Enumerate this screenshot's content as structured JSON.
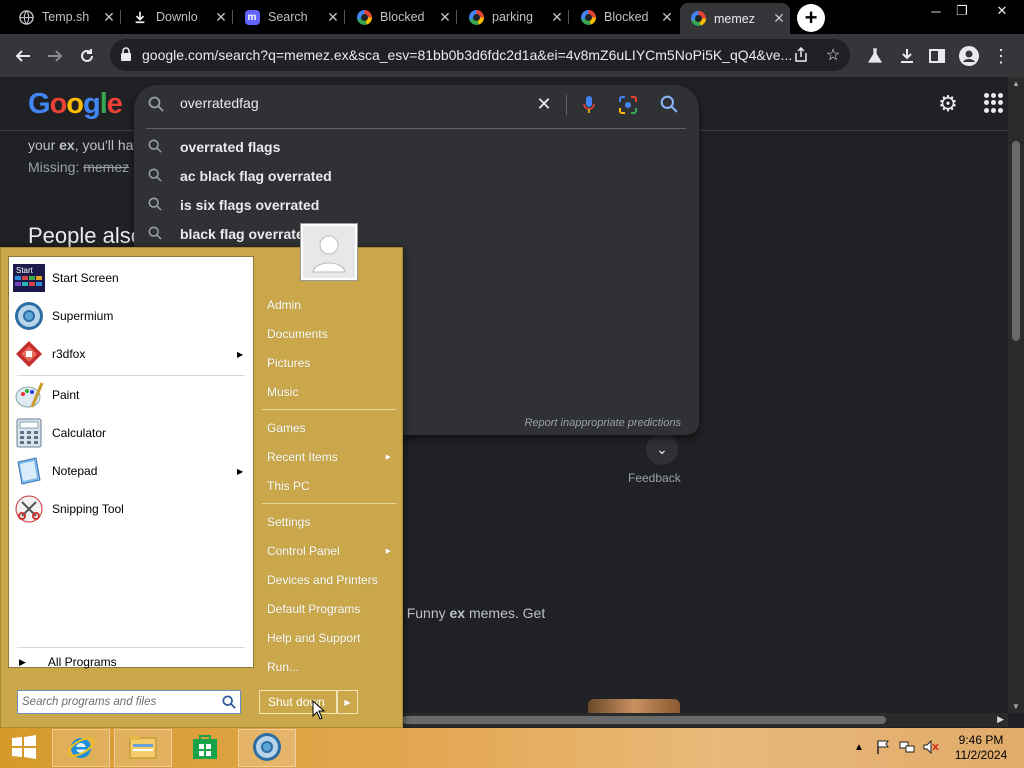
{
  "tabs": [
    {
      "title": "Temp.sh",
      "favicon": "globe-icon"
    },
    {
      "title": "Downlo",
      "favicon": "download-icon"
    },
    {
      "title": "Search",
      "favicon": "mastodon-icon"
    },
    {
      "title": "Blocked",
      "favicon": "google-icon"
    },
    {
      "title": "parking",
      "favicon": "google-icon"
    },
    {
      "title": "Blocked",
      "favicon": "google-icon"
    },
    {
      "title": "memez",
      "favicon": "google-icon"
    }
  ],
  "omnibox": {
    "url": "google.com/search?q=memez.ex&sca_esv=81bb0b3d6fdc2d1a&ei=4v8mZ6uLIYCm5NoPi5K_qQ4&ve..."
  },
  "search": {
    "query": "overratedfag",
    "suggestions": [
      "overrated flags",
      "ac black flag overrated",
      "is six flags overrated",
      "black flag overrated reddit"
    ],
    "report_label": "Report inappropriate predictions"
  },
  "page": {
    "snippet1_pre": "your ",
    "snippet1_bold": "ex",
    "snippet1_post": ", you'll hav",
    "missing_label": "Missing: ",
    "missing_struck": "memez",
    "people_also": "People also",
    "feedback": "Feedback",
    "snippet3_pre": "tion for Funny ",
    "snippet3_bold": "ex",
    "snippet3_post": " memes. Get"
  },
  "start_menu": {
    "programs": [
      {
        "label": "Start Screen",
        "icon": "start-screen-icon",
        "has_submenu": false
      },
      {
        "label": "Supermium",
        "icon": "supermium-icon",
        "has_submenu": false
      },
      {
        "label": "r3dfox",
        "icon": "r3dfox-icon",
        "has_submenu": true
      },
      {
        "label": "Paint",
        "icon": "paint-icon",
        "has_submenu": false
      },
      {
        "label": "Calculator",
        "icon": "calculator-icon",
        "has_submenu": false
      },
      {
        "label": "Notepad",
        "icon": "notepad-icon",
        "has_submenu": true
      },
      {
        "label": "Snipping Tool",
        "icon": "snipping-tool-icon",
        "has_submenu": false
      }
    ],
    "start_tile_text": "Start",
    "all_programs": "All Programs",
    "search_placeholder": "Search programs and files",
    "right_items": [
      {
        "label": "Admin",
        "has_submenu": false
      },
      {
        "label": "Documents",
        "has_submenu": false
      },
      {
        "label": "Pictures",
        "has_submenu": false
      },
      {
        "label": "Music",
        "has_submenu": false
      },
      {
        "label": "Games",
        "has_submenu": false
      },
      {
        "label": "Recent Items",
        "has_submenu": true
      },
      {
        "label": "This PC",
        "has_submenu": false
      },
      {
        "label": "Settings",
        "has_submenu": false
      },
      {
        "label": "Control Panel",
        "has_submenu": true
      },
      {
        "label": "Devices and Printers",
        "has_submenu": false
      },
      {
        "label": "Default Programs",
        "has_submenu": false
      },
      {
        "label": "Help and Support",
        "has_submenu": false
      },
      {
        "label": "Run...",
        "has_submenu": false
      }
    ],
    "shutdown_label": "Shut down"
  },
  "taskbar": {
    "items": [
      "start-icon",
      "internet-explorer-icon",
      "file-explorer-icon",
      "store-icon",
      "supermium-icon"
    ],
    "clock_time": "9:46 PM",
    "clock_date": "11/2/2024"
  }
}
